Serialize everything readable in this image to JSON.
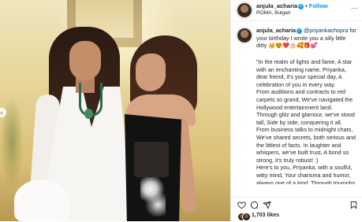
{
  "post": {
    "username": "anjula_acharia",
    "follow_label": "Follow",
    "separator": "•",
    "location": "ROMA, Bulgari",
    "more_label": "···"
  },
  "caption": {
    "username": "anjula_acharia",
    "mention": "@priyankachopra",
    "intro": "for your birthday I wrote you a silly little ditty 🥳😍❤️🎂🥰🎁💕",
    "body": "\"In the realm of lights and fame, A star with an enchanting name, Priyanka, dear friend, it's your special day, A celebration of you in every way.\nFrom auditions and contracts to red carpets so grand, We've navigated the Hollywood entertainment land.\nThrough glitz and glamour, we've stood tall, Side by side, conquering it all.\nFrom business talks to midnight chats, We've shared secrets, both serious and the littlest of facts. In laughter and whispers, we've built trust, A bond so strong, it's truly robust! :)\nHere's to you, Priyanka, with a soulful, witty mind, Your charisma and humor, always one of a kind. Through triumphs and challenges, laughter and"
  },
  "engagement": {
    "likes": "1,703 likes"
  },
  "icons": {
    "verified": "verified-badge-icon",
    "like": "heart-icon",
    "comment": "comment-icon",
    "share": "share-icon",
    "save": "bookmark-icon",
    "previous": "chevron-left-icon"
  },
  "colors": {
    "accent": "#0095f6",
    "verified": "#1d9bf0",
    "mention": "#00376b",
    "text": "#262626"
  }
}
